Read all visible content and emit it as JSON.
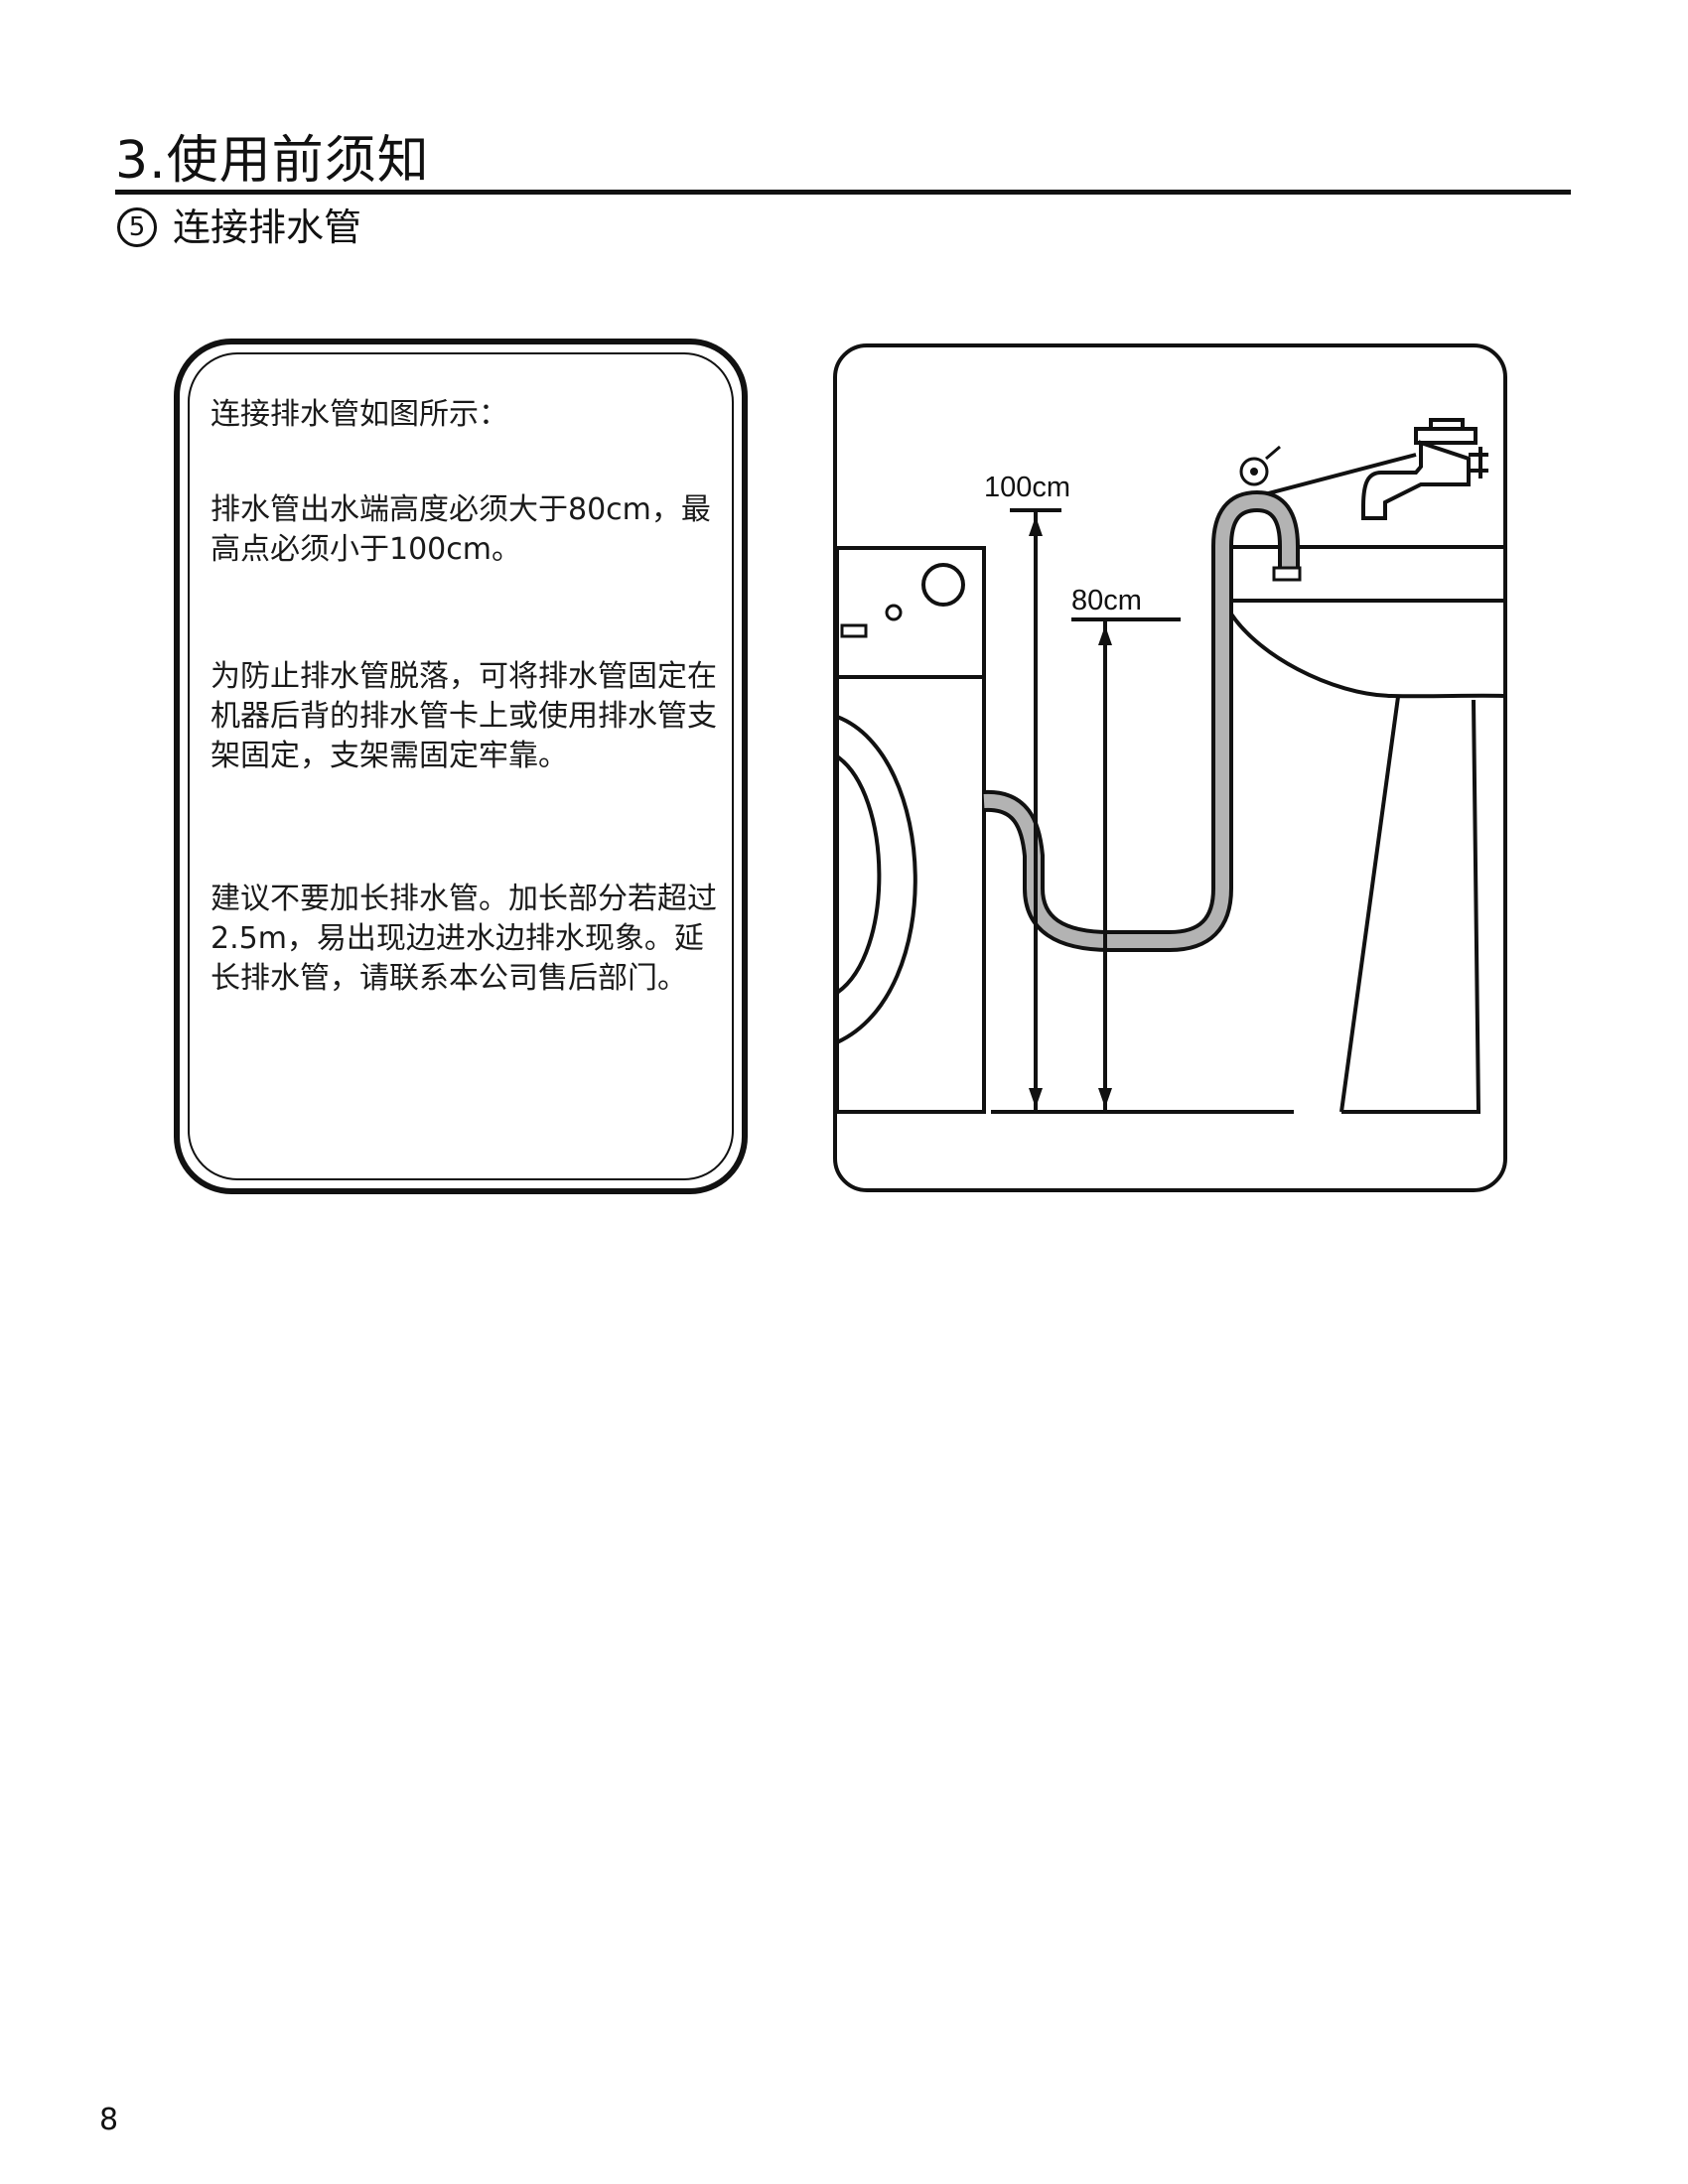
{
  "header": {
    "section_title": "3.使用前须知",
    "subsection_number": "5",
    "subsection_title": "连接排水管"
  },
  "instructions": {
    "p1": "连接排水管如图所示：",
    "p2": "排水管出水端高度必须大于80cm，最高点必须小于100cm。",
    "p3": "为防止排水管脱落，可将排水管固定在机器后背的排水管卡上或使用排水管支架固定，支架需固定牢靠。",
    "p4": "建议不要加长排水管。加长部分若超过2.5m，易出现边进水边排水现象。延长排水管，请联系本公司售后部门。"
  },
  "figure": {
    "label_max_height": "100cm",
    "label_min_height": "80cm",
    "icons": [
      "washing-machine-icon",
      "drain-hose-icon",
      "basin-icon",
      "faucet-icon",
      "height-arrow-icon"
    ]
  },
  "footer": {
    "page_number": "8"
  }
}
